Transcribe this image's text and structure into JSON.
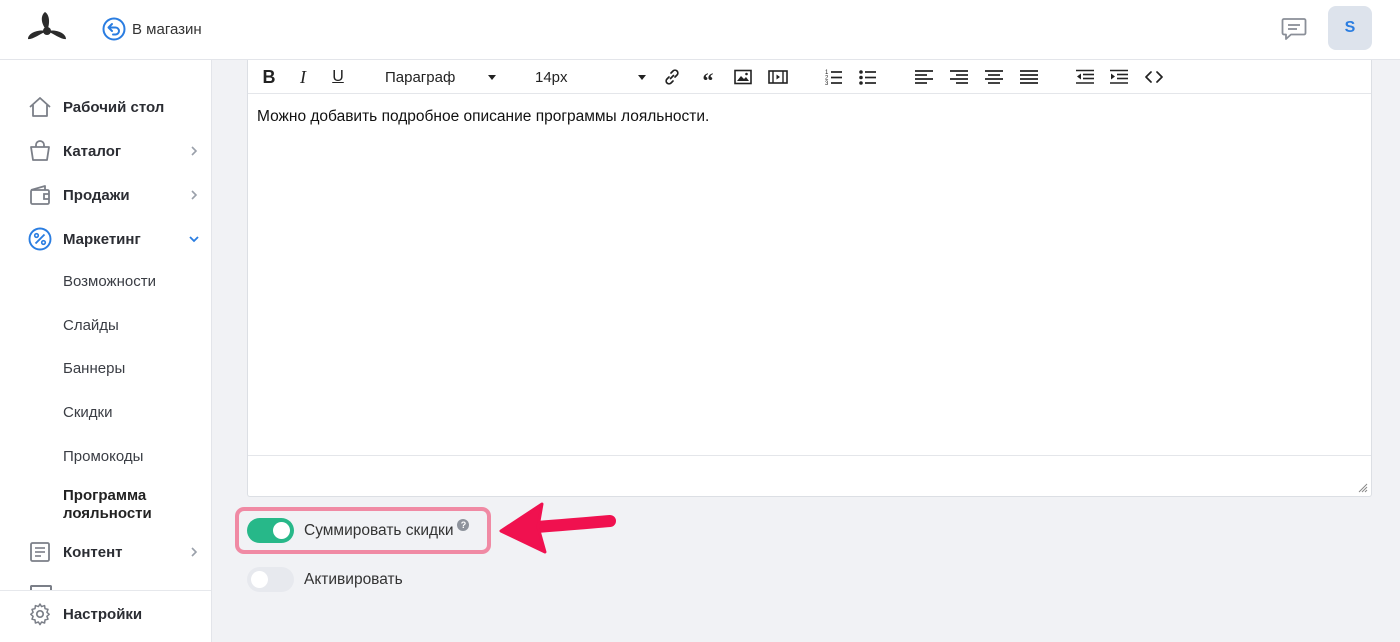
{
  "header": {
    "store_link_label": "В магазин",
    "avatar_initial": "S"
  },
  "sidebar": {
    "items": [
      {
        "label": "Рабочий стол",
        "icon": "home-icon"
      },
      {
        "label": "Каталог",
        "icon": "basket-icon"
      },
      {
        "label": "Продажи",
        "icon": "wallet-icon"
      },
      {
        "label": "Маркетинг",
        "icon": "percent-icon"
      },
      {
        "label": "Контент",
        "icon": "document-icon"
      },
      {
        "label": "Настройки",
        "icon": "gear-icon"
      }
    ],
    "marketing_sub": [
      "Возможности",
      "Слайды",
      "Баннеры",
      "Скидки",
      "Промокоды",
      "Программа лояльности"
    ]
  },
  "editor": {
    "paragraph_select": "Параграф",
    "font_size_select": "14px",
    "content_text": "Можно добавить подробное описание программы лояльности."
  },
  "toggles": {
    "sum_discounts": {
      "label": "Суммировать скидки",
      "on": true
    },
    "activate": {
      "label": "Активировать",
      "on": false
    }
  },
  "colors": {
    "accent": "#2a7de1",
    "toggle_on": "#27b889",
    "highlight": "#f08aa4",
    "arrow": "#f0114f"
  }
}
